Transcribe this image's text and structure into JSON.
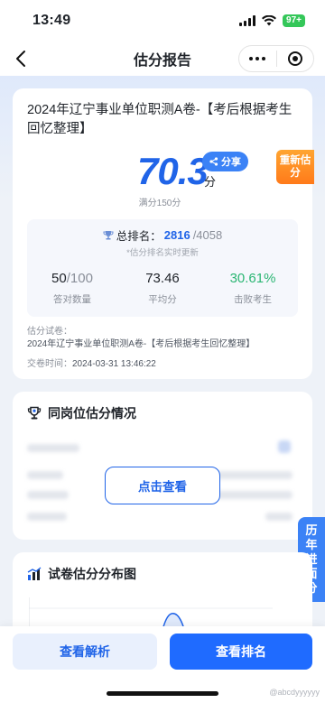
{
  "status_bar": {
    "time": "13:49",
    "battery": "97+"
  },
  "nav": {
    "title": "估分报告"
  },
  "report": {
    "exam_title": "2024年辽宁事业单位职测A卷-【考后根据考生回忆整理】",
    "score": "70.3",
    "score_unit": "分",
    "share_label": "分享",
    "full_score": "满分150分",
    "re_estimate": "重新估分",
    "rank_label": "总排名：",
    "rank": "2816",
    "rank_total": "/4058",
    "rank_note": "*估分排名实时更新",
    "stats": [
      {
        "value": "50",
        "suffix": "/100",
        "label": "答对数量"
      },
      {
        "value": "73.46",
        "suffix": "",
        "label": "平均分"
      },
      {
        "value": "30.61%",
        "suffix": "",
        "label": "击败考生"
      }
    ],
    "paper_label": "估分试卷：",
    "paper_value": "2024年辽宁事业单位职测A卷-【考后根据考生回忆整理】",
    "submit_label": "交卷时间：",
    "submit_time": "2024-03-31 13:46:22"
  },
  "peer": {
    "title": "同岗位估分情况",
    "view_button": "点击查看"
  },
  "history_tab": [
    "历",
    "年",
    "进",
    "面",
    "分"
  ],
  "distribution": {
    "title": "试卷估分分布图"
  },
  "bottom": {
    "analysis_button": "查看解析",
    "rank_button": "查看排名"
  },
  "watermark": "@abcdyyyyyy",
  "colors": {
    "primary": "#2064e8",
    "orange": "#ff8a1f",
    "green": "#2bb673"
  }
}
